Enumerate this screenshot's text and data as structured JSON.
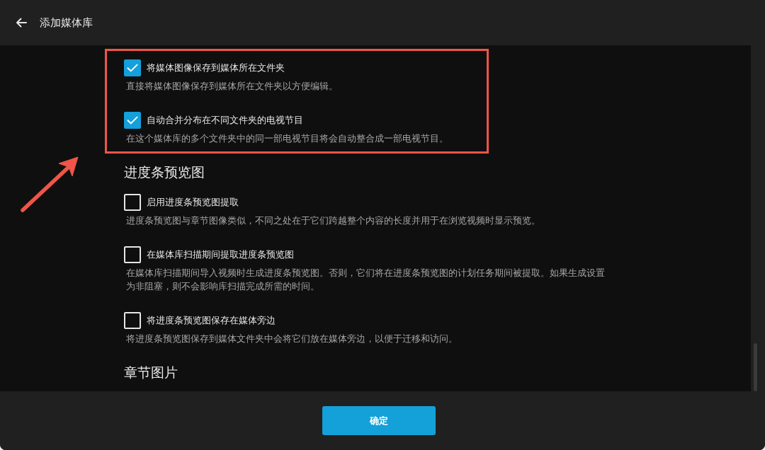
{
  "window": {
    "title": "添加媒体库"
  },
  "sections": [
    {
      "highlighted": true,
      "items": [
        {
          "label": "将媒体图像保存到媒体所在文件夹",
          "description": "直接将媒体图像保存到媒体所在文件夹以方便编辑。",
          "checked": true
        },
        {
          "label": "自动合并分布在不同文件夹的电视节目",
          "description": "在这个媒体库的多个文件夹中的同一部电视节目将会自动整合成一部电视节目。",
          "checked": true
        }
      ]
    },
    {
      "title": "进度条预览图",
      "highlighted": false,
      "items": [
        {
          "label": "启用进度条预览图提取",
          "description": "进度条预览图与章节图像类似，不同之处在于它们跨越整个内容的长度并用于在浏览视频时显示预览。",
          "checked": false
        },
        {
          "label": "在媒体库扫描期间提取进度条预览图",
          "description": "在媒体库扫描期间导入视频时生成进度条预览图。否则，它们将在进度条预览图的计划任务期间被提取。如果生成设置为非阻塞，则不会影响库扫描完成所需的时间。",
          "checked": false
        },
        {
          "label": "将进度条预览图保存在媒体旁边",
          "description": "将进度条预览图保存到媒体文件夹中会将它们放在媒体旁边，以便于迁移和访问。",
          "checked": false
        }
      ]
    },
    {
      "title": "章节图片",
      "highlighted": false
    }
  ],
  "confirm_button": {
    "label": "确定"
  }
}
